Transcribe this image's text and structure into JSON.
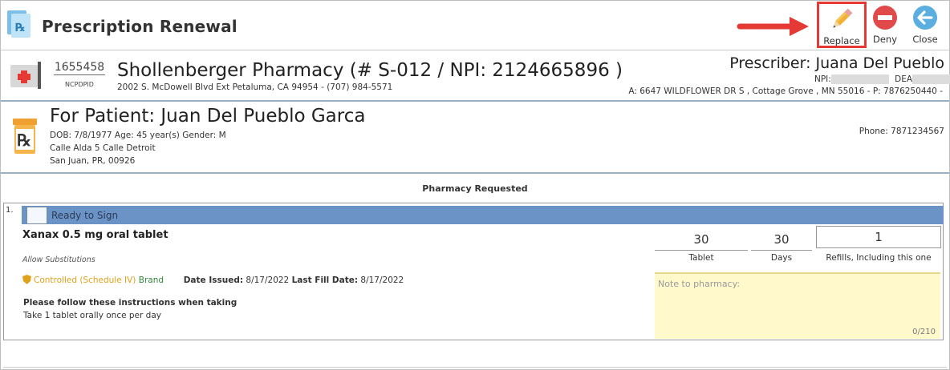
{
  "header": {
    "title": "Prescription Renewal",
    "toolbar": {
      "replace_label": "Replace",
      "deny_label": "Deny",
      "close_label": "Close"
    }
  },
  "pharmacy": {
    "ncpdp_id": "1655458",
    "ncpdp_label": "NCPDPID",
    "name_line": "Shollenberger Pharmacy  (# S-012  / NPI:  2124665896 )",
    "address": "2002 S. McDowell Blvd Ext Petaluma, CA 94954 - (707) 984-5571"
  },
  "prescriber": {
    "name_line": "Prescriber: Juana Del Pueblo",
    "npi_label": "NPI:",
    "dea_label": "DEA",
    "address": "A:  6647 WILDFLOWER DR S  ,  Cottage Grove ,  MN 55016  - P: 7876250440  -"
  },
  "patient": {
    "name_line": "For Patient:  Juan Del Pueblo Garca",
    "demographics": "DOB:  7/8/1977  Age:  45 year(s)  Gender:  M",
    "address1": "Calle Alda 5 Calle Detroit",
    "address2": "San Juan, PR, 00926",
    "phone": "Phone:  7871234567"
  },
  "section": {
    "title": "Pharmacy Requested"
  },
  "medication": {
    "number": "1.",
    "status": "Ready to Sign",
    "drug_name": "Xanax 0.5 mg oral tablet",
    "allow_substitutions": "Allow Substitutions",
    "controlled": "Controlled (Schedule IV)",
    "brand": "Brand",
    "date_issued_label": "Date Issued:",
    "date_issued": "8/17/2022",
    "last_fill_label": "Last Fill Date:",
    "last_fill": "8/17/2022",
    "instructions_title": "Please follow these instructions when taking",
    "instructions": "Take 1 tablet orally once per day",
    "quantity": "30",
    "quantity_unit": "Tablet",
    "days": "30",
    "days_label": "Days",
    "refills": "1",
    "refills_label": "Refills, Including this one",
    "note_placeholder": "Note to pharmacy:",
    "note_counter": "0/210"
  },
  "colors": {
    "status_bar": "#6b93c6",
    "highlight_border": "#e53935",
    "deny_icon": "#e04a4a",
    "close_icon": "#5aaee0",
    "controlled": "#e0a11b",
    "brand": "#2e8b3a"
  },
  "icons": {
    "app": "rx-document-icon",
    "replace": "pencil-icon",
    "deny": "minus-circle-icon",
    "close": "back-arrow-circle-icon",
    "pharmacy": "pharmacy-cross-icon",
    "patient": "rx-bottle-icon",
    "controlled": "shield-icon"
  }
}
